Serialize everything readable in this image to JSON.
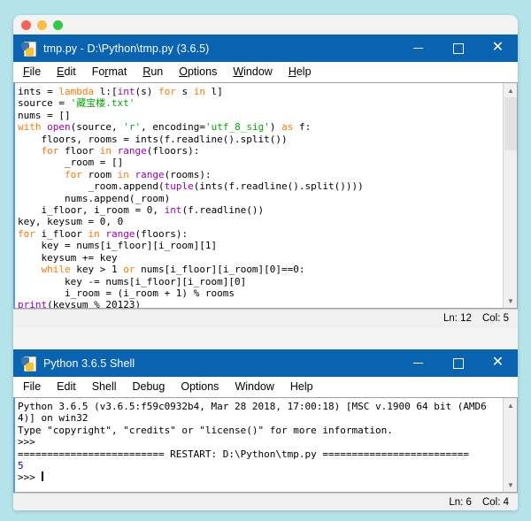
{
  "desktop": {
    "background_color": "#b4e3ea",
    "window_controls": {
      "close_dot": "close-dot",
      "minimize_dot": "minimize-dot",
      "maximize_dot": "zoom-dot"
    }
  },
  "editor_window": {
    "title": "tmp.py - D:\\Python\\tmp.py (3.6.5)",
    "icon": "python-file-icon",
    "controls": {
      "minimize": "–",
      "maximize": "□",
      "close": "✕"
    },
    "menu": [
      {
        "label": "File",
        "mnemonic": "F"
      },
      {
        "label": "Edit",
        "mnemonic": "E"
      },
      {
        "label": "Format",
        "mnemonic": "r"
      },
      {
        "label": "Run",
        "mnemonic": "R"
      },
      {
        "label": "Options",
        "mnemonic": "O"
      },
      {
        "label": "Window",
        "mnemonic": "W"
      },
      {
        "label": "Help",
        "mnemonic": "H"
      }
    ],
    "code_lines": [
      "ints = lambda l:[int(s) for s in l]",
      "source = '藏宝楼.txt'",
      "nums = []",
      "with open(source, 'r', encoding='utf_8_sig') as f:",
      "    floors, rooms = ints(f.readline().split())",
      "    for floor in range(floors):",
      "        _room = []",
      "        for room in range(rooms):",
      "            _room.append(tuple(ints(f.readline().split())))",
      "        nums.append(_room)",
      "    i_floor, i_room = 0, int(f.readline())",
      "key, keysum = 0, 0",
      "for i_floor in range(floors):",
      "    key = nums[i_floor][i_room][1]",
      "    keysum += key",
      "    while key > 1 or nums[i_floor][i_room][0]==0:",
      "        key -= nums[i_floor][i_room][0]",
      "        i_room = (i_room + 1) % rooms",
      "print(keysum % 20123)"
    ],
    "status": {
      "line": "Ln: 12",
      "column": "Col: 5"
    },
    "scrollbar": {
      "up_arrow": "⌃",
      "down_arrow": "⌄"
    }
  },
  "shell_window": {
    "title": "Python 3.6.5 Shell",
    "icon": "python-file-icon",
    "controls": {
      "minimize": "–",
      "maximize": "□",
      "close": "✕"
    },
    "menu": [
      {
        "label": "File"
      },
      {
        "label": "Edit"
      },
      {
        "label": "Shell"
      },
      {
        "label": "Debug"
      },
      {
        "label": "Options"
      },
      {
        "label": "Window"
      },
      {
        "label": "Help"
      }
    ],
    "output_lines": [
      "Python 3.6.5 (v3.6.5:f59c0932b4, Mar 28 2018, 17:00:18) [MSC v.1900 64 bit (AMD6",
      "4)] on win32",
      "Type \"copyright\", \"credits\" or \"license()\" for more information.",
      ">>>"
    ],
    "restart_banner": "========================= RESTART: D:\\Python\\tmp.py =========================",
    "program_output": "5",
    "prompt": ">>> ",
    "status": {
      "line": "Ln: 6",
      "column": "Col: 4"
    },
    "scrollbar": {
      "up_arrow": "⌃",
      "down_arrow": "⌄"
    }
  },
  "colors": {
    "titlebar": "#0a63b0",
    "desktop": "#b4e3ea",
    "keyword": "#ff7700",
    "builtin": "#9900bb",
    "string": "#00aa00",
    "definition": "#0000ff",
    "output": "#0000bb"
  }
}
